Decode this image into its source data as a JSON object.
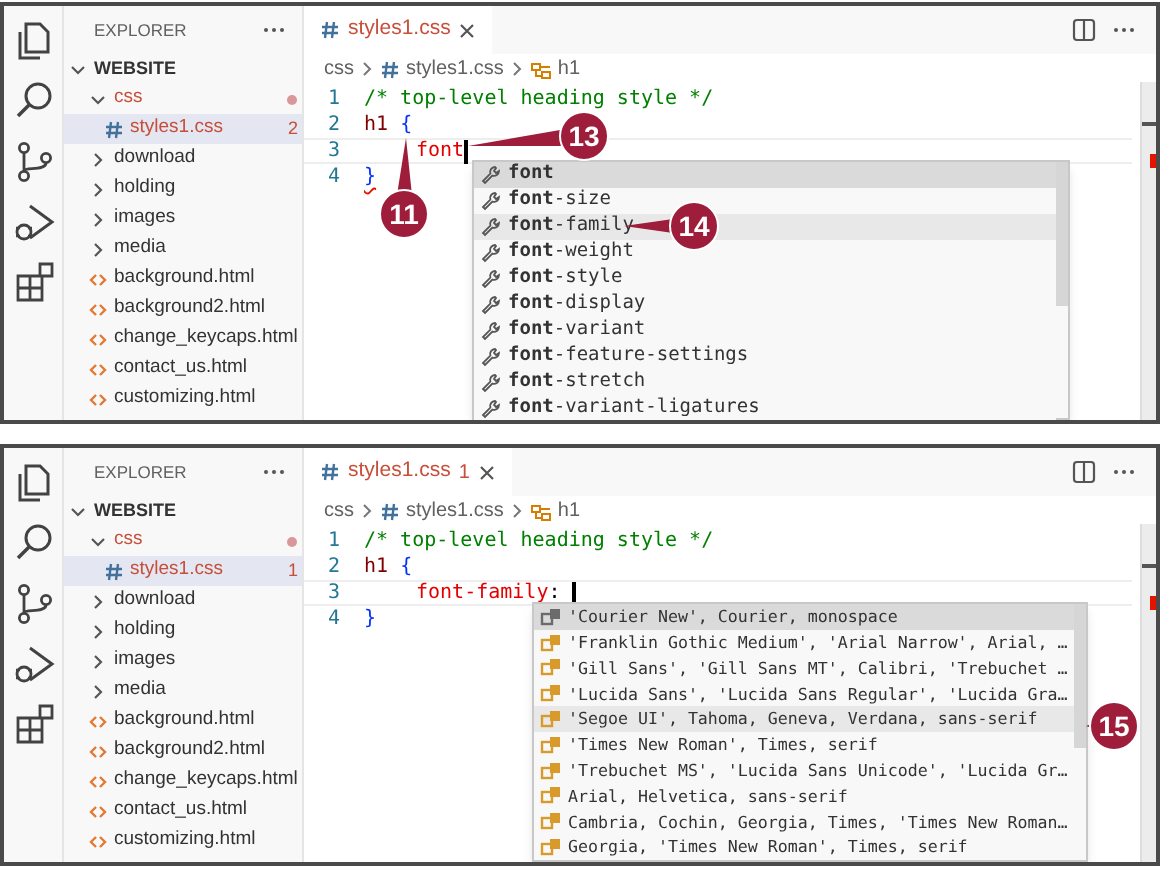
{
  "panels": [
    {
      "explorer": {
        "title": "EXPLORER",
        "root": {
          "label": "WEBSITE",
          "expanded": true,
          "children": [
            {
              "label": "css",
              "kind": "folder",
              "expanded": true,
              "error": true,
              "children": [
                {
                  "label": "styles1.css",
                  "kind": "css",
                  "selected": true,
                  "error": true,
                  "badge": "2"
                }
              ]
            },
            {
              "label": "download",
              "kind": "folder",
              "expanded": false
            },
            {
              "label": "holding",
              "kind": "folder",
              "expanded": false
            },
            {
              "label": "images",
              "kind": "folder",
              "expanded": false
            },
            {
              "label": "media",
              "kind": "folder",
              "expanded": false
            },
            {
              "label": "background.html",
              "kind": "html"
            },
            {
              "label": "background2.html",
              "kind": "html"
            },
            {
              "label": "change_keycaps.html",
              "kind": "html"
            },
            {
              "label": "contact_us.html",
              "kind": "html"
            },
            {
              "label": "customizing.html",
              "kind": "html"
            }
          ]
        }
      },
      "tab": {
        "label": "styles1.css",
        "error": true
      },
      "breadcrumb": [
        "css",
        "styles1.css",
        "h1"
      ],
      "code_lines": [
        {
          "number": "1",
          "tokens": [
            {
              "text": "/* top-level heading style */",
              "kind": "comment"
            }
          ]
        },
        {
          "number": "2",
          "tokens": [
            {
              "text": "h1 ",
              "kind": "selector"
            },
            {
              "text": "{",
              "kind": "brace"
            }
          ]
        },
        {
          "number": "3",
          "current": true,
          "tokens": [
            {
              "text": "font",
              "kind": "property",
              "indent": true
            }
          ]
        },
        {
          "number": "4",
          "tokens": [
            {
              "text": "}",
              "kind": "brace",
              "error": true
            }
          ]
        }
      ],
      "suggestions": [
        {
          "label": "**font**",
          "kind": "property",
          "selected": true,
          "hovered": false
        },
        {
          "label": "**font**-size",
          "kind": "property",
          "selected": false,
          "hovered": false
        },
        {
          "label": "**font**-family",
          "kind": "property",
          "selected": false,
          "hovered": true
        },
        {
          "label": "**font**-weight",
          "kind": "property",
          "selected": false,
          "hovered": false
        },
        {
          "label": "**font**-style",
          "kind": "property",
          "selected": false,
          "hovered": false
        },
        {
          "label": "**font**-display",
          "kind": "property",
          "selected": false,
          "hovered": false
        },
        {
          "label": "**font**-variant",
          "kind": "property",
          "selected": false,
          "hovered": false
        },
        {
          "label": "**font**-feature-settings",
          "kind": "property",
          "selected": false,
          "hovered": false
        },
        {
          "label": "**font**-stretch",
          "kind": "property",
          "selected": false,
          "hovered": false
        },
        {
          "label": "**font**-variant-ligatures",
          "kind": "property",
          "selected": false,
          "hovered": false
        }
      ],
      "callouts": [
        {
          "label": "11"
        },
        {
          "label": "13"
        },
        {
          "label": "14"
        }
      ]
    },
    {
      "explorer": {
        "title": "EXPLORER",
        "root": {
          "label": "WEBSITE",
          "expanded": true,
          "children": [
            {
              "label": "css",
              "kind": "folder",
              "expanded": true,
              "error": true,
              "children": [
                {
                  "label": "styles1.css",
                  "kind": "css",
                  "selected": true,
                  "error": true,
                  "badge": "1"
                }
              ]
            },
            {
              "label": "download",
              "kind": "folder",
              "expanded": false
            },
            {
              "label": "holding",
              "kind": "folder",
              "expanded": false
            },
            {
              "label": "images",
              "kind": "folder",
              "expanded": false
            },
            {
              "label": "media",
              "kind": "folder",
              "expanded": false
            },
            {
              "label": "background.html",
              "kind": "html"
            },
            {
              "label": "background2.html",
              "kind": "html"
            },
            {
              "label": "change_keycaps.html",
              "kind": "html"
            },
            {
              "label": "contact_us.html",
              "kind": "html"
            },
            {
              "label": "customizing.html",
              "kind": "html"
            }
          ]
        }
      },
      "tab": {
        "label": "styles1.css",
        "error": true,
        "badge": "1"
      },
      "breadcrumb": [
        "css",
        "styles1.css",
        "h1"
      ],
      "code_lines": [
        {
          "number": "1",
          "tokens": [
            {
              "text": "/* top-level heading style */",
              "kind": "comment"
            }
          ]
        },
        {
          "number": "2",
          "tokens": [
            {
              "text": "h1 ",
              "kind": "selector"
            },
            {
              "text": "{",
              "kind": "brace"
            }
          ]
        },
        {
          "number": "3",
          "current": true,
          "tokens": [
            {
              "text": "font-family",
              "kind": "property",
              "indent": true
            },
            {
              "text": ": ",
              "kind": "punct",
              "error": true
            }
          ]
        },
        {
          "number": "4",
          "tokens": [
            {
              "text": "}",
              "kind": "brace"
            }
          ]
        }
      ],
      "suggestions": [
        {
          "label": "'Courier New', Courier, monospace",
          "kind": "value",
          "selected": true,
          "hovered": false
        },
        {
          "label": "'Franklin Gothic Medium', 'Arial Narrow', Arial, …",
          "kind": "value",
          "selected": false,
          "hovered": false
        },
        {
          "label": "'Gill Sans', 'Gill Sans MT', Calibri, 'Trebuchet …",
          "kind": "value",
          "selected": false,
          "hovered": false
        },
        {
          "label": "'Lucida Sans', 'Lucida Sans Regular', 'Lucida Gra…",
          "kind": "value",
          "selected": false,
          "hovered": false
        },
        {
          "label": "'Segoe UI', Tahoma, Geneva, Verdana, sans-serif",
          "kind": "value",
          "selected": false,
          "hovered": true
        },
        {
          "label": "'Times New Roman', Times, serif",
          "kind": "value",
          "selected": false,
          "hovered": false
        },
        {
          "label": "'Trebuchet MS', 'Lucida Sans Unicode', 'Lucida Gr…",
          "kind": "value",
          "selected": false,
          "hovered": false
        },
        {
          "label": "Arial, Helvetica, sans-serif",
          "kind": "value",
          "selected": false,
          "hovered": false
        },
        {
          "label": "Cambria, Cochin, Georgia, Times, 'Times New Roman…",
          "kind": "value",
          "selected": false,
          "hovered": false
        },
        {
          "label": "Georgia, 'Times New Roman', Times, serif",
          "kind": "value",
          "selected": false,
          "hovered": false
        }
      ],
      "callouts": [
        {
          "label": "15"
        }
      ]
    }
  ]
}
